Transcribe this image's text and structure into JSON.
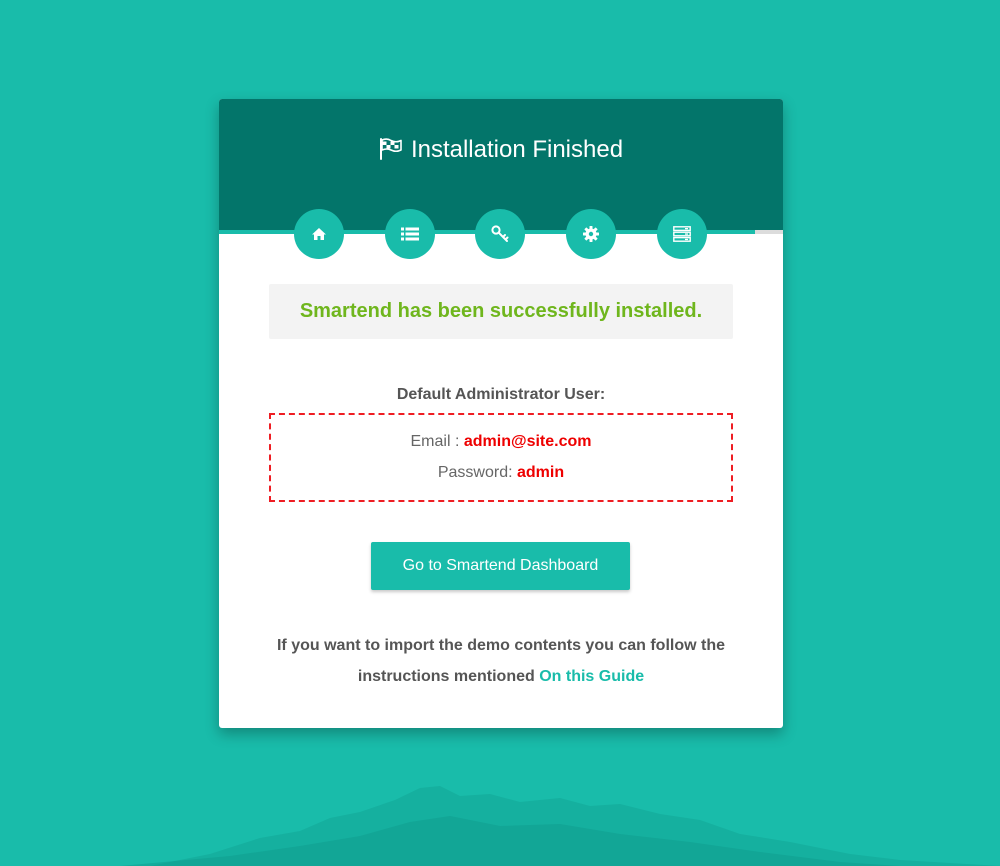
{
  "header": {
    "title": "Installation Finished"
  },
  "steps": [
    {
      "icon": "home-icon"
    },
    {
      "icon": "list-icon"
    },
    {
      "icon": "key-icon"
    },
    {
      "icon": "gear-icon"
    },
    {
      "icon": "server-icon"
    }
  ],
  "success": {
    "message": "Smartend has been successfully installed."
  },
  "admin": {
    "heading": "Default Administrator User:",
    "email_label": "Email : ",
    "email_value": "admin@site.com",
    "password_label": "Password: ",
    "password_value": "admin"
  },
  "dashboard_button": {
    "label": "Go to Smartend Dashboard"
  },
  "footer": {
    "line1": "If you want to import the demo contents you can follow the",
    "line2": "instructions mentioned ",
    "link_text": "On this Guide"
  },
  "colors": {
    "background": "#19bcaa",
    "header": "#03756a",
    "accent": "#19bcaa",
    "success_text": "#6fb61d",
    "credential_value": "#ee0000"
  }
}
